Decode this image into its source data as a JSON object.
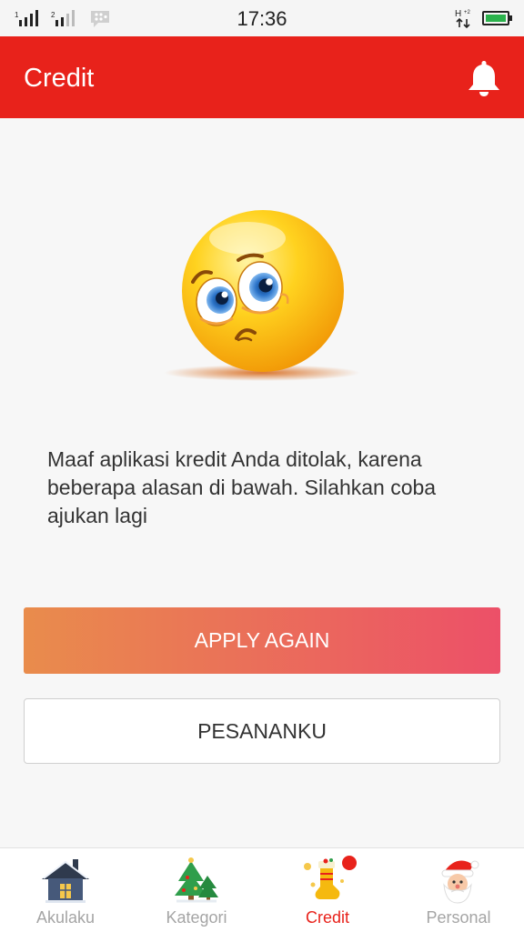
{
  "status_bar": {
    "time": "17:36"
  },
  "app_bar": {
    "title": "Credit"
  },
  "message": "Maaf aplikasi kredit Anda ditolak, karena beberapa alasan di bawah. Silahkan coba ajukan lagi",
  "buttons": {
    "apply_again": "APPLY AGAIN",
    "my_orders": "PESANANKU"
  },
  "bottom_nav": [
    {
      "label": "Akulaku",
      "icon": "house-icon",
      "active": false
    },
    {
      "label": "Kategori",
      "icon": "christmas-tree-icon",
      "active": false
    },
    {
      "label": "Credit",
      "icon": "stocking-icon",
      "active": true
    },
    {
      "label": "Personal",
      "icon": "santa-icon",
      "active": false
    }
  ],
  "colors": {
    "brand_red": "#e8221b",
    "gradient_start": "#e98c4c",
    "gradient_end": "#ec5068"
  }
}
